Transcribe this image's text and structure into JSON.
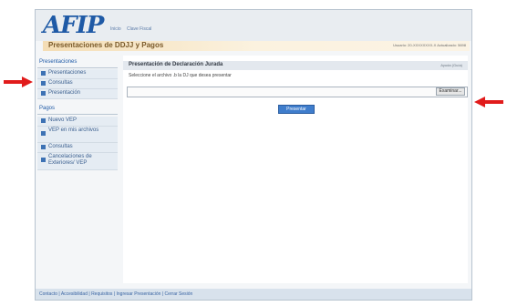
{
  "app": {
    "logo_text": "AFIP",
    "header_links": [
      "Inicio",
      "Clave Fiscal"
    ]
  },
  "banner": {
    "title": "Presentaciones de DDJJ y Pagos",
    "meta": "Usuario: 20-XXXXXXXX-X  Actualizado: 5698"
  },
  "sidebar": {
    "section_presentaciones": "Presentaciones",
    "presentaciones_items": [
      {
        "label": "Presentaciones"
      },
      {
        "label": "Consultas"
      },
      {
        "label": "Presentación"
      }
    ],
    "section_pagos": "Pagos",
    "pagos_items": [
      {
        "label": "Nuevo VEP"
      },
      {
        "label": "VEP en mis archivos"
      },
      {
        "label": "Consultas"
      },
      {
        "label": "Cancelaciones de Exteriores/ VEP"
      }
    ]
  },
  "content": {
    "title": "Presentación de Declaración Jurada",
    "aux": "Ayuda (Guía)",
    "instruction": "Seleccione el archivo .b la DJ que desea presentar",
    "file_input_value": "",
    "browse_label": "Examinar...",
    "submit_label": "Presentar"
  },
  "footer": {
    "text": "Contacto | Accesibilidad | Requisitos | Ingresar Presentación | Cerrar Sesión"
  },
  "colors": {
    "brand": "#1f5aa6",
    "arrow": "#e11b1b"
  }
}
